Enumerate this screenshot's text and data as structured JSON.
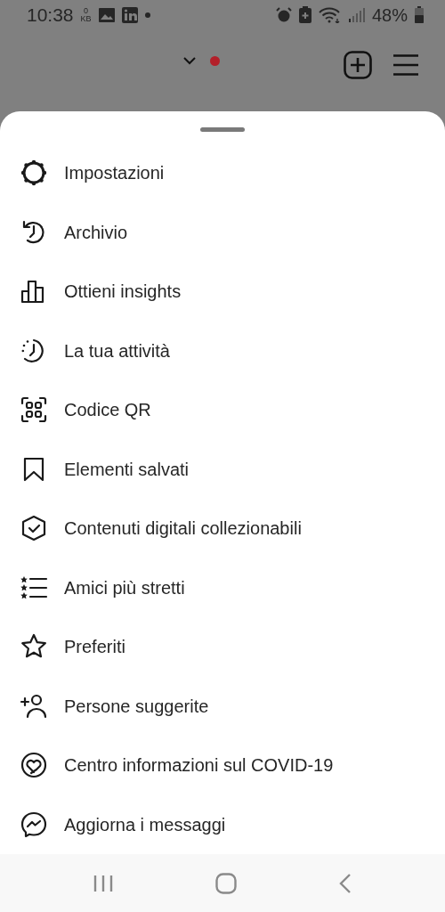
{
  "status_bar": {
    "time": "10:38",
    "data_counter": {
      "value": "0",
      "unit": "KB"
    },
    "battery": "48%"
  },
  "header": {
    "notification_dot": true
  },
  "menu": {
    "items": [
      {
        "label": "Impostazioni",
        "kind": "settings"
      },
      {
        "label": "Archivio",
        "kind": "archive"
      },
      {
        "label": "Ottieni insights",
        "kind": "insights"
      },
      {
        "label": "La tua attività",
        "kind": "activity"
      },
      {
        "label": "Codice QR",
        "kind": "qr"
      },
      {
        "label": "Elementi salvati",
        "kind": "saved"
      },
      {
        "label": "Contenuti digitali collezionabili",
        "kind": "collectibles"
      },
      {
        "label": "Amici più stretti",
        "kind": "close-friends"
      },
      {
        "label": "Preferiti",
        "kind": "favorites"
      },
      {
        "label": "Persone suggerite",
        "kind": "suggested"
      },
      {
        "label": "Centro informazioni sul COVID-19",
        "kind": "covid"
      },
      {
        "label": "Aggiorna i messaggi",
        "kind": "messages"
      }
    ]
  }
}
